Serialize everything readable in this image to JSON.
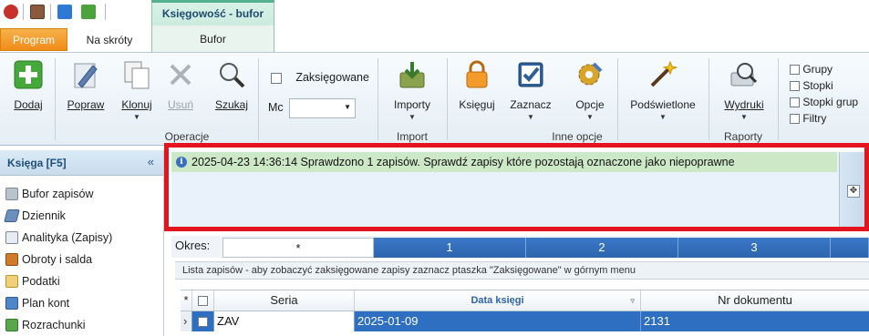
{
  "window": {
    "context_tab_title": "Księgowość - bufor"
  },
  "tabs": {
    "program": "Program",
    "skroty": "Na skróty",
    "bufor": "Bufor"
  },
  "ribbon": {
    "dodaj": "Dodaj",
    "popraw": "Popraw",
    "klonuj": "Klonuj",
    "usun": "Usuń",
    "szukaj": "Szukaj",
    "zaksiegowane": "Zaksięgowane",
    "mc_label": "Mc",
    "mc_value": "",
    "operacje": "Operacje",
    "importy": "Importy",
    "import": "Import",
    "ksieguj": "Księguj",
    "zaznacz": "Zaznacz",
    "opcje": "Opcje",
    "podswietlone": "Podświetlone",
    "inne_opcje": "Inne opcje",
    "wydruki": "Wydruki",
    "raporty": "Raporty",
    "grupy": "Grupy",
    "stopki": "Stopki",
    "stopki_grup": "Stopki grup",
    "filtry": "Filtry"
  },
  "sidebar": {
    "title": "Księga [F5]",
    "collapse": "«",
    "items": [
      {
        "label": "Bufor zapisów"
      },
      {
        "label": "Dziennik"
      },
      {
        "label": "Analityka (Zapisy)"
      },
      {
        "label": "Obroty i salda"
      },
      {
        "label": "Podatki"
      },
      {
        "label": "Plan kont"
      },
      {
        "label": "Rozrachunki"
      }
    ]
  },
  "message": {
    "text": "2025-04-23 14:36:14  Sprawdzono 1 zapisów. Sprawdź zapisy które pozostają oznaczone jako niepoprawne"
  },
  "okres": {
    "label": "Okres:",
    "tabs": [
      "*",
      "1",
      "2",
      "3"
    ]
  },
  "grid": {
    "hint": "Lista zapisów - aby zobaczyć zaksięgowane zapisy zaznacz ptaszka \"Zaksięgowane\" w górnym menu",
    "columns": {
      "star": "*",
      "seria": "Seria",
      "data": "Data księgi",
      "nr": "Nr dokumentu"
    },
    "rows": [
      {
        "seria": "ZAV",
        "data": "2025-01-09",
        "nr": "2131"
      }
    ]
  },
  "colors": {
    "accent_orange": "#f08c1a",
    "selection_blue": "#2f6fc2",
    "message_green": "#cde8c6",
    "highlight_red": "#e4141f"
  }
}
